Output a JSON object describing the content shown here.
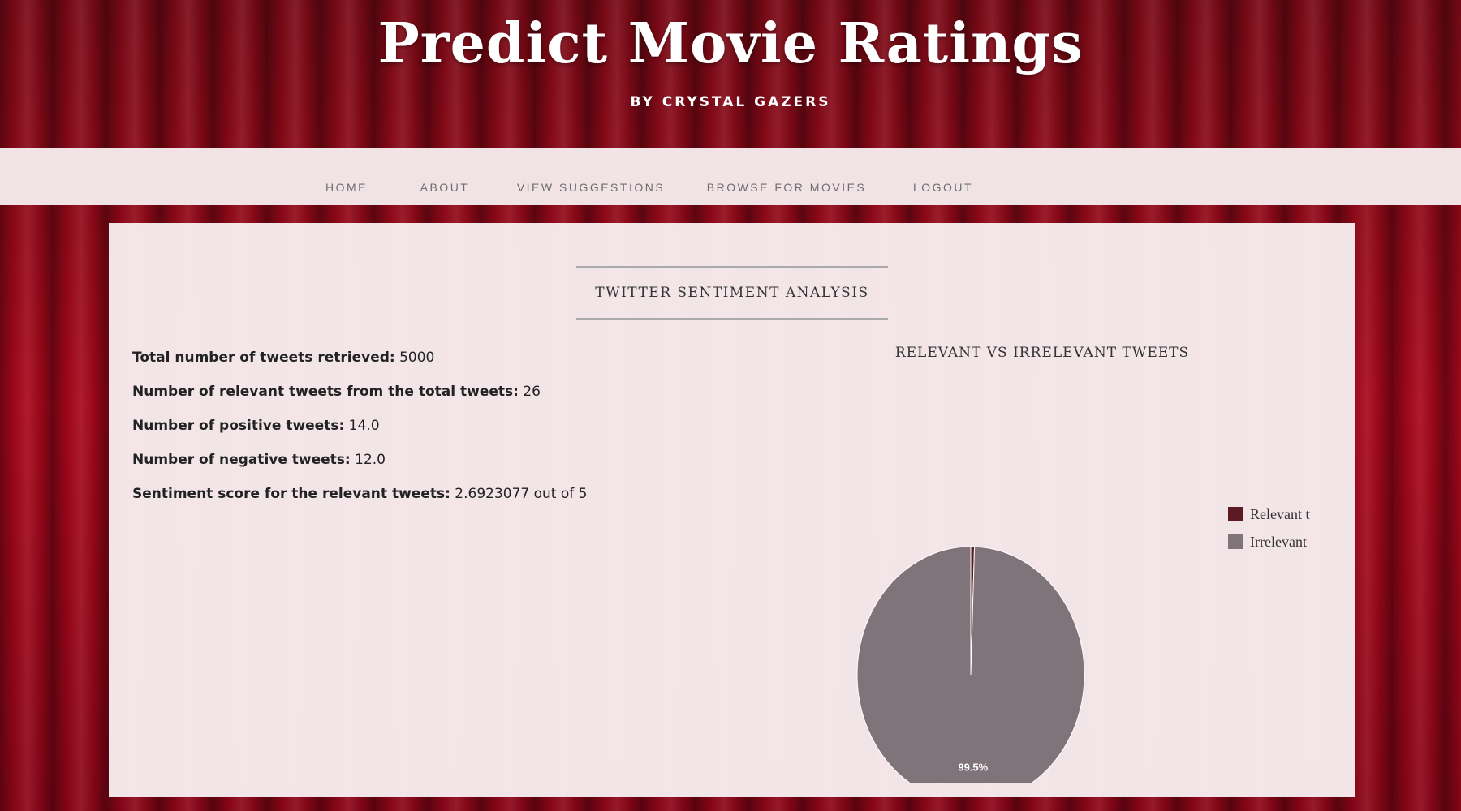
{
  "header": {
    "title": "Predict Movie Ratings",
    "subtitle": "BY CRYSTAL GAZERS"
  },
  "nav": {
    "items": [
      {
        "label": "HOME",
        "name": "nav-home"
      },
      {
        "label": "ABOUT",
        "name": "nav-about"
      },
      {
        "label": "VIEW SUGGESTIONS",
        "name": "nav-view-suggestions"
      },
      {
        "label": "BROWSE FOR MOVIES",
        "name": "nav-browse-for-movies"
      },
      {
        "label": "LOGOUT",
        "name": "nav-logout"
      }
    ]
  },
  "main": {
    "heading": "TWITTER SENTIMENT ANALYSIS",
    "stats": [
      {
        "label": "Total number of tweets retrieved:",
        "value": "5000"
      },
      {
        "label": "Number of relevant tweets from the total tweets:",
        "value": "26"
      },
      {
        "label": "Number of positive tweets:",
        "value": "14.0"
      },
      {
        "label": "Number of negative tweets:",
        "value": "12.0"
      },
      {
        "label": "Sentiment score for the relevant tweets:",
        "value": "2.6923077 out of 5"
      }
    ]
  },
  "chart_data": {
    "type": "pie",
    "title": "RELEVANT VS IRRELEVANT TWEETS",
    "legend_position": "right",
    "slices": [
      {
        "label": "Relevant tweets",
        "value": 26,
        "color": "#5c1a22"
      },
      {
        "label": "Irrelevant tweets",
        "value": 4974,
        "color": "#7f7479"
      }
    ],
    "data_labels": [
      {
        "slice": "Irrelevant tweets",
        "text": "99.5%"
      }
    ]
  },
  "colors": {
    "curtain": "#a8081c",
    "panel": "#f6ecee",
    "nav_text": "#6e6e6e"
  }
}
